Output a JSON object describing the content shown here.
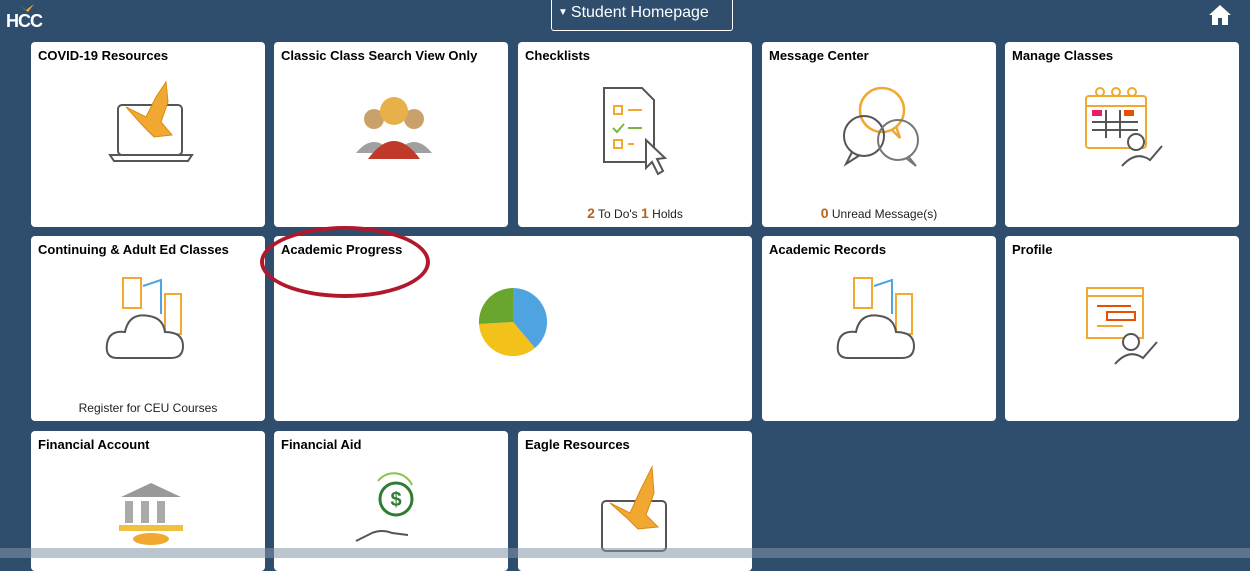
{
  "header": {
    "logo_text": "HCC",
    "homepage_label": "Student Homepage",
    "home_icon": "home-icon"
  },
  "tiles": {
    "covid": {
      "title": "COVID-19 Resources",
      "icon": "eagle-laptop-icon"
    },
    "classic_search": {
      "title": "Classic Class Search View Only",
      "icon": "people-group-icon"
    },
    "checklists": {
      "title": "Checklists",
      "icon": "checklist-icon",
      "todo_count": "2",
      "todo_label": "To Do's",
      "holds_count": "1",
      "holds_label": "Holds"
    },
    "message_center": {
      "title": "Message Center",
      "icon": "chat-bubbles-icon",
      "unread_count": "0",
      "unread_label": "Unread Message(s)"
    },
    "manage_classes": {
      "title": "Manage Classes",
      "icon": "calendar-person-icon"
    },
    "continuing_ed": {
      "title": "Continuing & Adult Ed Classes",
      "icon": "cloud-documents-icon",
      "footer": "Register for CEU Courses"
    },
    "academic_progress": {
      "title": "Academic Progress",
      "icon": "pie-chart-icon"
    },
    "academic_records": {
      "title": "Academic Records",
      "icon": "cloud-documents-icon"
    },
    "profile": {
      "title": "Profile",
      "icon": "profile-form-icon"
    },
    "financial_account": {
      "title": "Financial Account",
      "icon": "bank-icon"
    },
    "financial_aid": {
      "title": "Financial Aid",
      "icon": "dollar-hand-icon"
    },
    "eagle_resources": {
      "title": "Eagle Resources",
      "icon": "eagle-laptop-icon"
    }
  },
  "colors": {
    "background": "#2f4d6d",
    "accent_orange": "#f0a830",
    "count_orange": "#b5651d",
    "annotation_red": "#b2182b"
  }
}
